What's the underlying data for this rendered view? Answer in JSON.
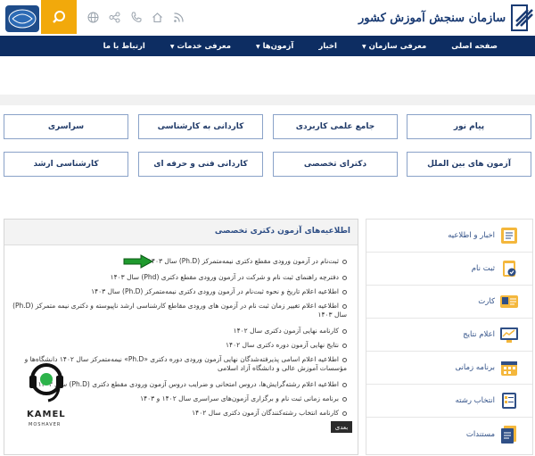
{
  "header": {
    "org_name": "سازمان سنجش آموزش کشور",
    "icons": [
      "rss-icon",
      "home-icon",
      "phone-icon",
      "share-icon",
      "globe-icon"
    ]
  },
  "nav": {
    "items": [
      {
        "label": "صفحه اصلی",
        "dropdown": false
      },
      {
        "label": "معرفی سازمان",
        "dropdown": true
      },
      {
        "label": "اخبار",
        "dropdown": false
      },
      {
        "label": "آزمون‌ها",
        "dropdown": true
      },
      {
        "label": "معرفی خدمات",
        "dropdown": true
      },
      {
        "label": "ارتباط با ما",
        "dropdown": false
      }
    ]
  },
  "exam_buttons": [
    {
      "label": "پیام نور"
    },
    {
      "label": "جامع علمی کاربردی"
    },
    {
      "label": "کاردانی به کارشناسی"
    },
    {
      "label": "سراسری"
    },
    {
      "label": "آزمون های بین الملل"
    },
    {
      "label": "دکترای تخصصی"
    },
    {
      "label": "کاردانی فنی و حرفه ای"
    },
    {
      "label": "کارشناسی ارشد"
    }
  ],
  "sidebar": {
    "items": [
      {
        "label": "اخبار و اطلاعیه"
      },
      {
        "label": "ثبت نام"
      },
      {
        "label": "کارت"
      },
      {
        "label": "اعلام نتایج"
      },
      {
        "label": "برنامه زمانی"
      },
      {
        "label": "انتخاب رشته"
      },
      {
        "label": "مستندات"
      }
    ]
  },
  "announcements": {
    "title": "اطلاعیه‌های آزمون دکتری تخصصی",
    "items": [
      "ثبت‌نام در آزمون ورودی مقطع دکتری نیمه‌متمرکز (Ph.D) سال ۱۴۰۳",
      "دفترچه راهنمای ثبت نام و شرکت در آزمون ورودی مقطع دکتری (Phd) سال ۱۴۰۳",
      "اطلاعیه اعلام تاریخ و نحوه ثبت‌نام در آزمون ورودی دکتری نیمه‌متمرکز (Ph.D) سال ۱۴۰۳",
      "اطلاعیه اعلام تغییر زمان ثبت نام در آزمون های ورودی مقاطع کارشناسی ارشد ناپیوسته و دکتری نیمه متمرکز (Ph.D) سال ۱۴۰۳",
      "کارنامه نهایی آزمون دکتری سال ۱۴۰۲",
      "نتایج نهایی آزمون دوره دکتری سال ۱۴۰۲",
      "اطلاعیه اعلام اسامی پذیرفته‌شدگان نهایی آزمون ورودی دوره دکتری «Ph.D» نیمه‌متمرکز سال ۱۴۰۲ دانشگاه‌ها و مؤسسات آموزش عالی و دانشگاه آزاد اسلامی",
      "اطلاعیه اعلام رشته‌گرایش‌ها، دروس امتحانی و ضرایب دروس آزمون ورودی مقطع دکتری (Ph.D) سال ۱۴۰۳",
      "برنامه زمانی ثبت نام و برگزاری آزمون‌های سراسری سال ۱۴۰۲ و ۱۴۰۳",
      "کارنامه انتخاب رشته‌کنندگان آزمون دکتری سال ۱۴۰۲"
    ],
    "more_label": "بعدی"
  },
  "watermark": {
    "brand": "KAMEL",
    "sub": "MOSHAVER"
  },
  "colors": {
    "nav_bg": "#0d2d62",
    "search_bg": "#f2a90b",
    "button_border": "#8aa2c8",
    "arrow_green": "#1f9a2e"
  }
}
